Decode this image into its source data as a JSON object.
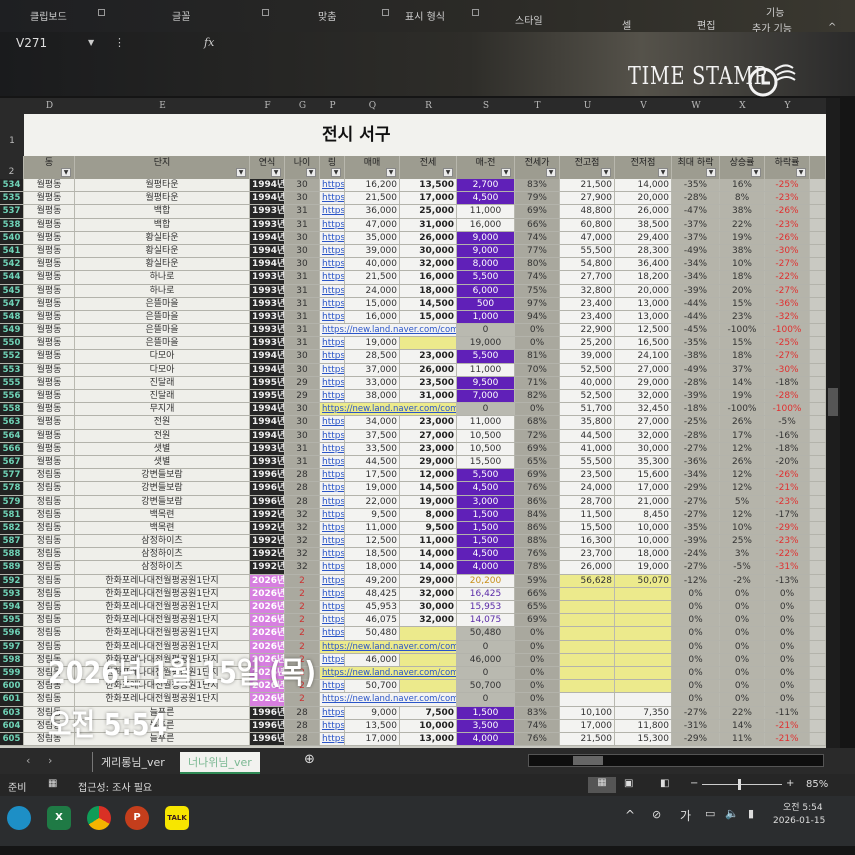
{
  "ribbon": {
    "groups": [
      "클립보드",
      "글꼴",
      "맞춤",
      "표시 형식",
      "스타일",
      "셀",
      "편집",
      "기능",
      "추가 기능"
    ]
  },
  "formula_bar": {
    "name_box": "V271",
    "fx": "fx",
    "value": ""
  },
  "watermark": "TIME STAMP",
  "sheet": {
    "title": "전시 서구",
    "column_letters": [
      "D",
      "E",
      "F",
      "G",
      "P",
      "Q",
      "R",
      "S",
      "T",
      "U",
      "V",
      "W",
      "X",
      "Y"
    ],
    "row1_number": "1",
    "row2_number": "2",
    "headers": [
      "동",
      "단지",
      "연식",
      "나이",
      "링",
      "매매",
      "전세",
      "매-전",
      "전세가",
      "전고점",
      "전저점",
      "최대 하락",
      "상승률",
      "하락률"
    ],
    "rows": [
      [
        "534",
        "월평동",
        "월평타운",
        "1994년",
        "30",
        "https",
        "16,200",
        "13,500",
        "2,700",
        "83%",
        "21,500",
        "14,000",
        "-35%",
        "16%",
        "-25%"
      ],
      [
        "535",
        "월평동",
        "월평타운",
        "1994년",
        "30",
        "https",
        "21,500",
        "17,000",
        "4,500",
        "79%",
        "27,900",
        "20,000",
        "-28%",
        "8%",
        "-23%"
      ],
      [
        "537",
        "월평동",
        "백합",
        "1993년",
        "31",
        "https",
        "36,000",
        "25,000",
        "11,000",
        "69%",
        "48,800",
        "26,000",
        "-47%",
        "38%",
        "-26%"
      ],
      [
        "538",
        "월평동",
        "백합",
        "1993년",
        "31",
        "https",
        "47,000",
        "31,000",
        "16,000",
        "66%",
        "60,800",
        "38,500",
        "-37%",
        "22%",
        "-23%"
      ],
      [
        "540",
        "월평동",
        "황실타운",
        "1994년",
        "30",
        "https",
        "35,000",
        "26,000",
        "9,000",
        "74%",
        "47,000",
        "29,400",
        "-37%",
        "19%",
        "-26%"
      ],
      [
        "541",
        "월평동",
        "황실타운",
        "1994년",
        "30",
        "https",
        "39,000",
        "30,000",
        "9,000",
        "77%",
        "55,500",
        "28,300",
        "-49%",
        "38%",
        "-30%"
      ],
      [
        "542",
        "월평동",
        "황실타운",
        "1994년",
        "30",
        "https",
        "40,000",
        "32,000",
        "8,000",
        "80%",
        "54,800",
        "36,400",
        "-34%",
        "10%",
        "-27%"
      ],
      [
        "544",
        "월평동",
        "하나로",
        "1993년",
        "31",
        "https",
        "21,500",
        "16,000",
        "5,500",
        "74%",
        "27,700",
        "18,200",
        "-34%",
        "18%",
        "-22%"
      ],
      [
        "545",
        "월평동",
        "하나로",
        "1993년",
        "31",
        "https",
        "24,000",
        "18,000",
        "6,000",
        "75%",
        "32,800",
        "20,000",
        "-39%",
        "20%",
        "-27%"
      ],
      [
        "547",
        "월평동",
        "은뜰마을",
        "1993년",
        "31",
        "https",
        "15,000",
        "14,500",
        "500",
        "97%",
        "23,400",
        "13,000",
        "-44%",
        "15%",
        "-36%"
      ],
      [
        "548",
        "월평동",
        "은뜰마을",
        "1993년",
        "31",
        "https",
        "16,000",
        "15,000",
        "1,000",
        "94%",
        "23,400",
        "13,000",
        "-44%",
        "23%",
        "-32%"
      ],
      [
        "549",
        "월평동",
        "은뜰마을",
        "1993년",
        "31",
        "https://new.land.naver.com/comp",
        "",
        "",
        "0",
        "0%",
        "22,900",
        "12,500",
        "-45%",
        "-100%",
        "-100%"
      ],
      [
        "550",
        "월평동",
        "은뜰마을",
        "1993년",
        "31",
        "https",
        "19,000",
        "",
        "19,000",
        "0%",
        "25,200",
        "16,500",
        "-35%",
        "15%",
        "-25%"
      ],
      [
        "552",
        "월평동",
        "다모아",
        "1994년",
        "30",
        "https",
        "28,500",
        "23,000",
        "5,500",
        "81%",
        "39,000",
        "24,100",
        "-38%",
        "18%",
        "-27%"
      ],
      [
        "553",
        "월평동",
        "다모아",
        "1994년",
        "30",
        "https",
        "37,000",
        "26,000",
        "11,000",
        "70%",
        "52,500",
        "27,000",
        "-49%",
        "37%",
        "-30%"
      ],
      [
        "555",
        "월평동",
        "진달래",
        "1995년",
        "29",
        "https",
        "33,000",
        "23,500",
        "9,500",
        "71%",
        "40,000",
        "29,000",
        "-28%",
        "14%",
        "-18%"
      ],
      [
        "556",
        "월평동",
        "진달래",
        "1995년",
        "29",
        "https",
        "38,000",
        "31,000",
        "7,000",
        "82%",
        "52,500",
        "32,000",
        "-39%",
        "19%",
        "-28%"
      ],
      [
        "558",
        "월평동",
        "무지개",
        "1994년",
        "30",
        "https://new.land.naver.com/comp",
        "",
        "",
        "0",
        "0%",
        "51,700",
        "32,450",
        "-18%",
        "-100%",
        "-100%"
      ],
      [
        "563",
        "월평동",
        "전원",
        "1994년",
        "30",
        "https",
        "34,000",
        "23,000",
        "11,000",
        "68%",
        "35,800",
        "27,000",
        "-25%",
        "26%",
        "-5%"
      ],
      [
        "564",
        "월평동",
        "전원",
        "1994년",
        "30",
        "https",
        "37,500",
        "27,000",
        "10,500",
        "72%",
        "44,500",
        "32,000",
        "-28%",
        "17%",
        "-16%"
      ],
      [
        "566",
        "월평동",
        "샛별",
        "1993년",
        "31",
        "https",
        "33,500",
        "23,000",
        "10,500",
        "69%",
        "41,000",
        "30,000",
        "-27%",
        "12%",
        "-18%"
      ],
      [
        "567",
        "월평동",
        "샛별",
        "1993년",
        "31",
        "https",
        "44,500",
        "29,000",
        "15,500",
        "65%",
        "55,500",
        "35,300",
        "-36%",
        "26%",
        "-20%"
      ],
      [
        "577",
        "정림동",
        "강변들보람",
        "1996년",
        "28",
        "https",
        "17,500",
        "12,000",
        "5,500",
        "69%",
        "23,500",
        "15,600",
        "-34%",
        "12%",
        "-26%"
      ],
      [
        "578",
        "정림동",
        "강변들보람",
        "1996년",
        "28",
        "https",
        "19,000",
        "14,500",
        "4,500",
        "76%",
        "24,000",
        "17,000",
        "-29%",
        "12%",
        "-21%"
      ],
      [
        "579",
        "정림동",
        "강변들보람",
        "1996년",
        "28",
        "https",
        "22,000",
        "19,000",
        "3,000",
        "86%",
        "28,700",
        "21,000",
        "-27%",
        "5%",
        "-23%"
      ],
      [
        "581",
        "정림동",
        "백목련",
        "1992년",
        "32",
        "https",
        "9,500",
        "8,000",
        "1,500",
        "84%",
        "11,500",
        "8,450",
        "-27%",
        "12%",
        "-17%"
      ],
      [
        "582",
        "정림동",
        "백목련",
        "1992년",
        "32",
        "https",
        "11,000",
        "9,500",
        "1,500",
        "86%",
        "15,500",
        "10,000",
        "-35%",
        "10%",
        "-29%"
      ],
      [
        "587",
        "정림동",
        "삼정하이츠",
        "1992년",
        "32",
        "https",
        "12,500",
        "11,000",
        "1,500",
        "88%",
        "16,300",
        "10,000",
        "-39%",
        "25%",
        "-23%"
      ],
      [
        "588",
        "정림동",
        "삼정하이츠",
        "1992년",
        "32",
        "https",
        "18,500",
        "14,000",
        "4,500",
        "76%",
        "23,700",
        "18,000",
        "-24%",
        "3%",
        "-22%"
      ],
      [
        "589",
        "정림동",
        "삼정하이츠",
        "1992년",
        "32",
        "https",
        "18,000",
        "14,000",
        "4,000",
        "78%",
        "26,000",
        "19,000",
        "-27%",
        "-5%",
        "-31%"
      ],
      [
        "592",
        "정림동",
        "한화포레나대전월평공원1단지",
        "2026년",
        "2",
        "https",
        "49,200",
        "29,000",
        "20,200",
        "59%",
        "56,628",
        "50,070",
        "-12%",
        "-2%",
        "-13%"
      ],
      [
        "593",
        "정림동",
        "한화포레나대전월평공원1단지",
        "2026년",
        "2",
        "https",
        "48,425",
        "32,000",
        "16,425",
        "66%",
        "",
        "",
        "0%",
        "0%",
        "0%"
      ],
      [
        "594",
        "정림동",
        "한화포레나대전월평공원1단지",
        "2026년",
        "2",
        "https",
        "45,953",
        "30,000",
        "15,953",
        "65%",
        "",
        "",
        "0%",
        "0%",
        "0%"
      ],
      [
        "595",
        "정림동",
        "한화포레나대전월평공원1단지",
        "2026년",
        "2",
        "https",
        "46,075",
        "32,000",
        "14,075",
        "69%",
        "",
        "",
        "0%",
        "0%",
        "0%"
      ],
      [
        "596",
        "정림동",
        "한화포레나대전월평공원1단지",
        "2026년",
        "2",
        "https",
        "50,480",
        "",
        "50,480",
        "0%",
        "",
        "",
        "0%",
        "0%",
        "0%"
      ],
      [
        "597",
        "정림동",
        "한화포레나대전월평공원1단지",
        "2026년",
        "2",
        "https://new.land.naver.com/comp",
        "",
        "",
        "0",
        "0%",
        "",
        "",
        "0%",
        "0%",
        "0%"
      ],
      [
        "598",
        "정림동",
        "한화포레나대전월평공원1단지",
        "2026년",
        "2",
        "https",
        "46,000",
        "",
        "46,000",
        "0%",
        "",
        "",
        "0%",
        "0%",
        "0%"
      ],
      [
        "599",
        "정림동",
        "한화포레나대전월평공원1단지",
        "2026년",
        "2",
        "https://new.land.naver.com/comp",
        "",
        "",
        "0",
        "0%",
        "",
        "",
        "0%",
        "0%",
        "0%"
      ],
      [
        "600",
        "정림동",
        "한화포레나대전월평공원1단지",
        "2026년",
        "2",
        "https",
        "50,700",
        "",
        "50,700",
        "0%",
        "",
        "",
        "0%",
        "0%",
        "0%"
      ],
      [
        "601",
        "정림동",
        "한화포레나대전월평공원1단지",
        "2026년",
        "2",
        "https://new.land.naver.com/comp",
        "",
        "",
        "0",
        "0%",
        "",
        "",
        "0%",
        "0%",
        "0%"
      ],
      [
        "603",
        "정림동",
        "늘푸른",
        "1996년",
        "28",
        "https",
        "9,000",
        "7,500",
        "1,500",
        "83%",
        "10,100",
        "7,350",
        "-27%",
        "22%",
        "-11%"
      ],
      [
        "604",
        "정림동",
        "늘푸른",
        "1996년",
        "28",
        "https",
        "13,500",
        "10,000",
        "3,500",
        "74%",
        "17,000",
        "11,800",
        "-31%",
        "14%",
        "-21%"
      ],
      [
        "605",
        "정림동",
        "늘푸른",
        "1996년",
        "28",
        "https",
        "17,000",
        "13,000",
        "4,000",
        "76%",
        "21,500",
        "15,300",
        "-29%",
        "11%",
        "-21%"
      ]
    ]
  },
  "sheet_tabs": [
    "게리롱님_ver",
    "너나위님_ver"
  ],
  "status_bar": {
    "ready": "준비",
    "accessibility": "접근성: 조사 필요",
    "zoom": "85%",
    "zoom_value": 85
  },
  "taskbar": {
    "ime": "가",
    "time": "오전 5:54",
    "date": "2026-01-15",
    "apps": [
      "Edge",
      "X",
      "Chrome",
      "P",
      "TALK"
    ]
  },
  "overlay": {
    "date": "2026년 1월 15일 (목)",
    "time": "오전 5:54"
  },
  "colors": {
    "accent_purple": "#6020b8",
    "new_build_pink": "#d77fe0",
    "empty_yellow": "#ecea8c",
    "negative_red": "#e03030"
  }
}
